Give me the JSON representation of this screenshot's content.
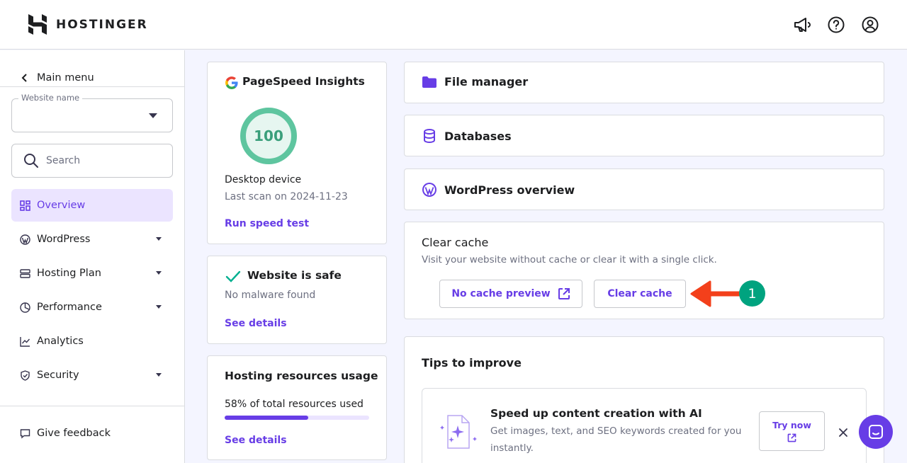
{
  "header": {
    "brand": "HOSTINGER",
    "icons": [
      "megaphone-icon",
      "help-icon",
      "account-icon"
    ]
  },
  "sidebar": {
    "main_menu": "Main menu",
    "website_name_label": "Website name",
    "search_placeholder": "Search",
    "items": [
      {
        "label": "Overview",
        "icon": "overview-icon",
        "active": true
      },
      {
        "label": "WordPress",
        "icon": "wordpress-icon"
      },
      {
        "label": "Hosting Plan",
        "icon": "server-icon"
      },
      {
        "label": "Performance",
        "icon": "gauge-icon"
      },
      {
        "label": "Analytics",
        "icon": "chart-icon"
      },
      {
        "label": "Security",
        "icon": "shield-icon"
      }
    ],
    "feedback": "Give feedback"
  },
  "pagespeed": {
    "title": "PageSpeed Insights",
    "score": "100",
    "device": "Desktop device",
    "last_scan": "Last scan on 2024-11-23",
    "action": "Run speed test"
  },
  "safety": {
    "title": "Website is safe",
    "subtitle": "No malware found",
    "action": "See details"
  },
  "resources": {
    "title": "Hosting resources usage",
    "usage_text": "58% of total resources used",
    "usage_fraction": 0.58,
    "action": "See details"
  },
  "quick_links": [
    {
      "label": "File manager",
      "icon": "folder-icon"
    },
    {
      "label": "Databases",
      "icon": "database-icon"
    },
    {
      "label": "WordPress overview",
      "icon": "wordpress-icon"
    }
  ],
  "cache": {
    "title": "Clear cache",
    "description": "Visit your website without cache or clear it with a single click.",
    "preview_button": "No cache preview",
    "clear_button": "Clear cache",
    "annotation_number": "1"
  },
  "tips": {
    "title": "Tips to improve",
    "tip_title": "Speed up content creation with AI",
    "tip_line1": "Get images, text, and SEO keywords created for you",
    "tip_line2": "instantly.",
    "try_button": "Try now"
  },
  "colors": {
    "accent": "#673de6",
    "success": "#5ec59f",
    "annotation_arrow": "#f3401b",
    "annotation_badge": "#00a37f"
  }
}
